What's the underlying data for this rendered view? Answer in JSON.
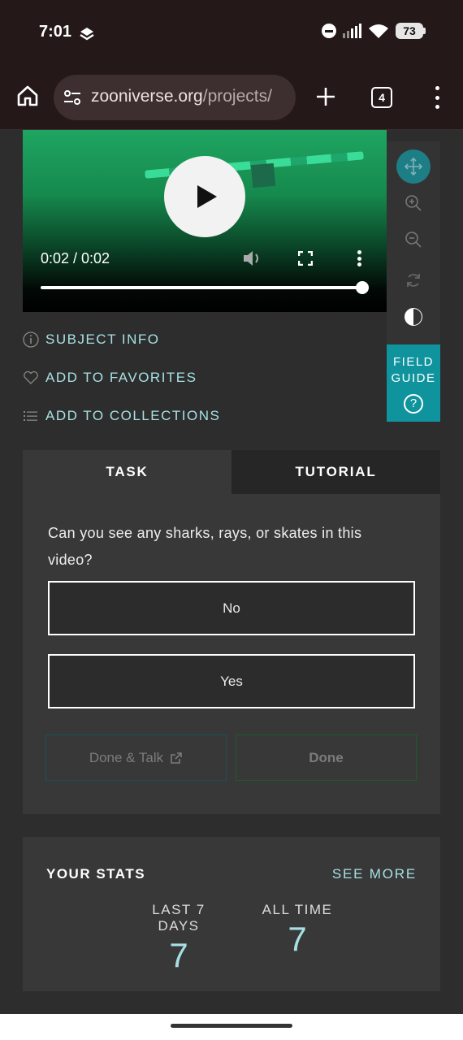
{
  "status_bar": {
    "time": "7:01",
    "battery": "73"
  },
  "browser": {
    "url_host": "zooniverse.org",
    "url_path": "/projects/",
    "tab_count": "4"
  },
  "video": {
    "time": "0:02 / 0:02",
    "progress": 1.0
  },
  "toolbar": {
    "field_guide_line1": "FIELD",
    "field_guide_line2": "GUIDE",
    "help_glyph": "?"
  },
  "meta_links": {
    "subject_info": "SUBJECT INFO",
    "favorites": "ADD TO FAVORITES",
    "collections": "ADD TO COLLECTIONS"
  },
  "task_panel": {
    "tabs": [
      "TASK",
      "TUTORIAL"
    ],
    "question": "Can you see any sharks, rays, or skates in this video?",
    "answers": [
      "No",
      "Yes"
    ],
    "done_talk_label": "Done & Talk",
    "done_label": "Done"
  },
  "stats": {
    "title": "YOUR STATS",
    "see_more": "SEE MORE",
    "last7_label": "LAST 7 DAYS",
    "last7_value": "7",
    "alltime_label": "ALL TIME",
    "alltime_value": "7"
  },
  "colors": {
    "accent": "#0f949e",
    "link": "#a7e0e4",
    "panel": "#383838",
    "background": "#2d2d2d"
  }
}
